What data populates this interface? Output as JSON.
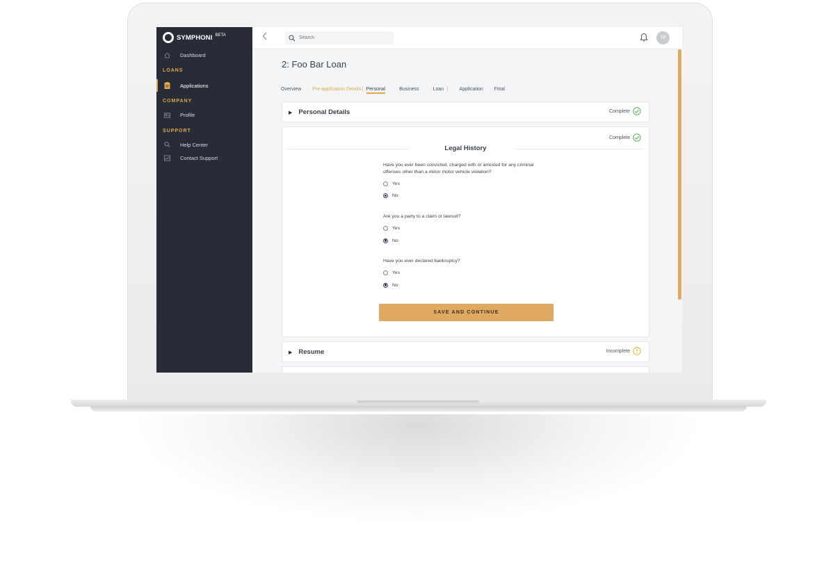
{
  "sidebar": {
    "brand": "SYMPHONI",
    "brand_badge": "BETA",
    "dashboard": "Dashboard",
    "section_loans": "LOANS",
    "applications": "Applications",
    "section_company": "COMPANY",
    "profile": "Profile",
    "section_support": "SUPPORT",
    "help_center": "Help Center",
    "contact_support": "Contact Support"
  },
  "topbar": {
    "search_placeholder": "Search",
    "avatar_initials": "TP"
  },
  "page": {
    "title": "2: Foo Bar Loan"
  },
  "tabs": {
    "overview": "Overview",
    "pre_application": "Pre-application Details",
    "paren_open": "(",
    "personal": "Personal",
    "business": "Business",
    "loan": "Loan",
    "paren_close": ")",
    "application": "Application",
    "final": "Final"
  },
  "cards": {
    "personal_details": {
      "title": "Personal Details",
      "status": "Complete"
    },
    "legal_history": {
      "status": "Complete",
      "heading": "Legal History",
      "questions": [
        {
          "text": "Have you ever been convicted, charged with or arrested for any criminal offenses other than a minor motor vehicle violation?",
          "yes": "Yes",
          "no": "No",
          "selected": "No"
        },
        {
          "text": "Are you a party to a claim or lawsuit?",
          "yes": "Yes",
          "no": "No",
          "selected": "No"
        },
        {
          "text": "Have you ever declared bankruptcy?",
          "yes": "Yes",
          "no": "No",
          "selected": "No"
        }
      ],
      "save_label": "SAVE AND CONTINUE"
    },
    "resume": {
      "title": "Resume",
      "status": "Incomplete"
    }
  },
  "colors": {
    "accent": "#e0a84a",
    "sidebar_bg": "#272c36",
    "complete": "#4caf50",
    "incomplete": "#e9b21b"
  }
}
